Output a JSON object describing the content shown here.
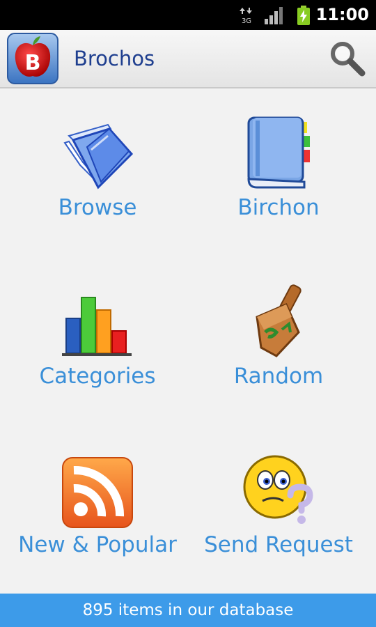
{
  "status_bar": {
    "time": "11:00",
    "network_type": "3G",
    "icons": [
      "data-arrows-icon",
      "signal-icon",
      "battery-charging-icon"
    ]
  },
  "app_bar": {
    "title": "Brochos",
    "logo_letter": "B",
    "search_icon": "search-icon"
  },
  "menu": [
    {
      "label": "Browse",
      "icon": "folder-icon"
    },
    {
      "label": "Birchon",
      "icon": "book-icon"
    },
    {
      "label": "Categories",
      "icon": "bar-chart-icon"
    },
    {
      "label": "Random",
      "icon": "dreidel-icon"
    },
    {
      "label": "New & Popular",
      "icon": "rss-icon"
    },
    {
      "label": "Send Request",
      "icon": "question-face-icon"
    }
  ],
  "footer": {
    "text": "895 items in our database"
  },
  "colors": {
    "accent": "#3a8fd8",
    "title": "#1f3f8f",
    "footer_bg": "#3d9be9"
  }
}
